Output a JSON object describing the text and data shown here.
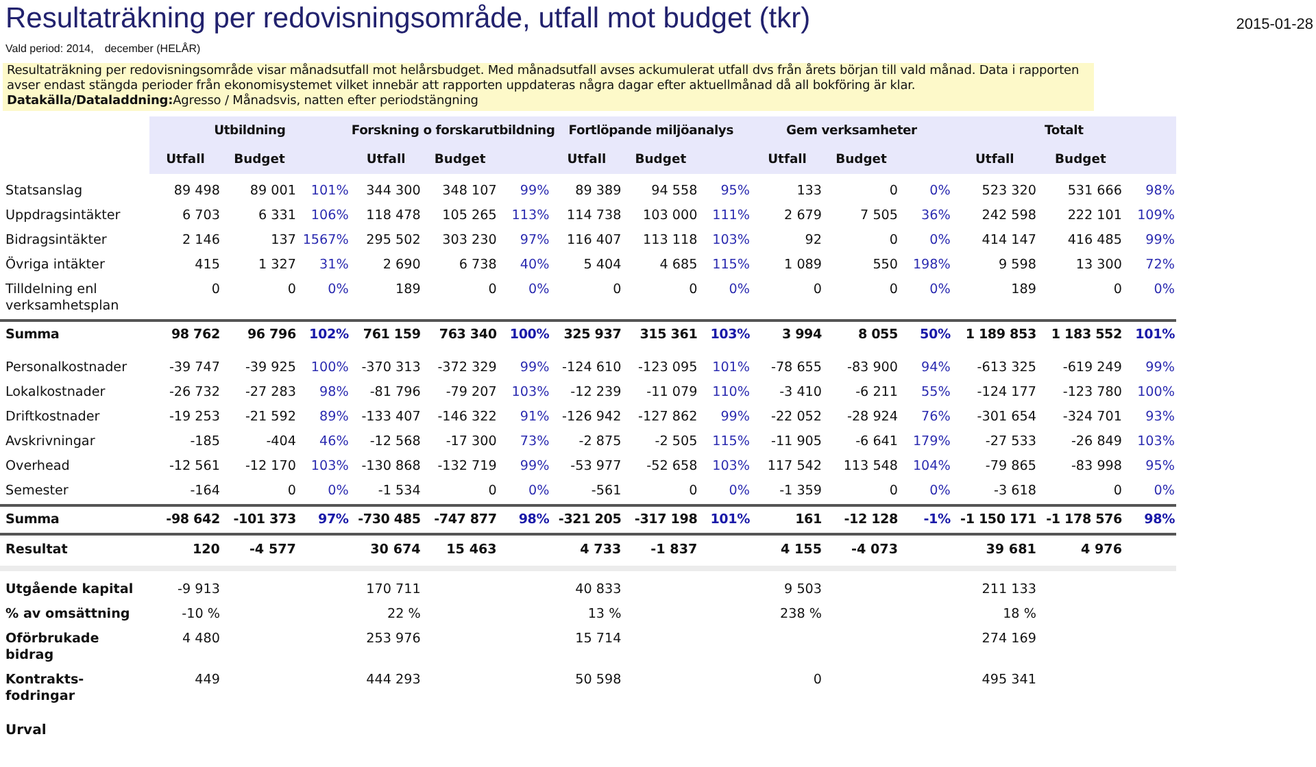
{
  "title": "Resultaträkning per redovisningsområde, utfall mot budget (tkr)",
  "date": "2015-01-28",
  "period": {
    "label": "Vald period: 2014,",
    "value": "december (HELÅR)"
  },
  "note": {
    "text": "Resultaträkning per redovisningsområde visar månadsutfall mot helårsbudget. Med månadsutfall avses ackumulerat utfall dvs från årets början till vald månad. Data i rapporten avser endast stängda perioder från ekonomisystemet vilket innebär att rapporten uppdateras några dagar efter aktuellmånad då all bokföring är klar.",
    "source_label": "Datakälla/Dataladdning:",
    "source_text": "Agresso / Månadsvis, natten efter periodstängning"
  },
  "table": {
    "areas": [
      {
        "name": "Utbildning",
        "columns": [
          "Utfall",
          "Budget"
        ]
      },
      {
        "name": "Forskning o forskarutbildning",
        "columns": [
          "Utfall",
          "Budget"
        ]
      },
      {
        "name": "Fortlöpande miljöanalys",
        "columns": [
          "Utfall",
          "Budget"
        ]
      },
      {
        "name": "Gem verksamheter",
        "columns": [
          "Utfall",
          "Budget"
        ]
      },
      {
        "name": "Totalt",
        "columns": [
          "Utfall",
          "Budget"
        ]
      }
    ],
    "rows": [
      {
        "kind": "line",
        "label": "Statsanslag",
        "cells": [
          "89 498",
          "89 001",
          "101%",
          "344 300",
          "348 107",
          "99%",
          "89 389",
          "94 558",
          "95%",
          "133",
          "0",
          "0%",
          "523 320",
          "531 666",
          "98%"
        ]
      },
      {
        "kind": "line",
        "label": "Uppdragsintäkter",
        "cells": [
          "6 703",
          "6 331",
          "106%",
          "118 478",
          "105 265",
          "113%",
          "114 738",
          "103 000",
          "111%",
          "2 679",
          "7 505",
          "36%",
          "242 598",
          "222 101",
          "109%"
        ]
      },
      {
        "kind": "line",
        "label": "Bidragsintäkter",
        "cells": [
          "2 146",
          "137",
          "1567%",
          "295 502",
          "303 230",
          "97%",
          "116 407",
          "113 118",
          "103%",
          "92",
          "0",
          "0%",
          "414 147",
          "416 485",
          "99%"
        ]
      },
      {
        "kind": "line",
        "label": "Övriga intäkter",
        "cells": [
          "415",
          "1 327",
          "31%",
          "2 690",
          "6 738",
          "40%",
          "5 404",
          "4 685",
          "115%",
          "1 089",
          "550",
          "198%",
          "9 598",
          "13 300",
          "72%"
        ]
      },
      {
        "kind": "line",
        "label": "Tilldelning enl verksamhetsplan",
        "cells": [
          "0",
          "0",
          "0%",
          "189",
          "0",
          "0%",
          "0",
          "0",
          "0%",
          "0",
          "0",
          "0%",
          "189",
          "0",
          "0%"
        ]
      },
      {
        "kind": "sum",
        "label": "Summa",
        "cells": [
          "98 762",
          "96 796",
          "102%",
          "761 159",
          "763 340",
          "100%",
          "325 937",
          "315 361",
          "103%",
          "3 994",
          "8 055",
          "50%",
          "1 189 853",
          "1 183 552",
          "101%"
        ]
      },
      {
        "kind": "line",
        "label": "Personalkostnader",
        "cells": [
          "-39 747",
          "-39 925",
          "100%",
          "-370 313",
          "-372 329",
          "99%",
          "-124 610",
          "-123 095",
          "101%",
          "-78 655",
          "-83 900",
          "94%",
          "-613 325",
          "-619 249",
          "99%"
        ]
      },
      {
        "kind": "line",
        "label": "Lokalkostnader",
        "cells": [
          "-26 732",
          "-27 283",
          "98%",
          "-81 796",
          "-79 207",
          "103%",
          "-12 239",
          "-11 079",
          "110%",
          "-3 410",
          "-6 211",
          "55%",
          "-124 177",
          "-123 780",
          "100%"
        ]
      },
      {
        "kind": "line",
        "label": "Driftkostnader",
        "cells": [
          "-19 253",
          "-21 592",
          "89%",
          "-133 407",
          "-146 322",
          "91%",
          "-126 942",
          "-127 862",
          "99%",
          "-22 052",
          "-28 924",
          "76%",
          "-301 654",
          "-324 701",
          "93%"
        ]
      },
      {
        "kind": "line",
        "label": "Avskrivningar",
        "cells": [
          "-185",
          "-404",
          "46%",
          "-12 568",
          "-17 300",
          "73%",
          "-2 875",
          "-2 505",
          "115%",
          "-11 905",
          "-6 641",
          "179%",
          "-27 533",
          "-26 849",
          "103%"
        ]
      },
      {
        "kind": "line",
        "label": "Overhead",
        "cells": [
          "-12 561",
          "-12 170",
          "103%",
          "-130 868",
          "-132 719",
          "99%",
          "-53 977",
          "-52 658",
          "103%",
          "117 542",
          "113 548",
          "104%",
          "-79 865",
          "-83 998",
          "95%"
        ]
      },
      {
        "kind": "line",
        "label": "Semester",
        "cells": [
          "-164",
          "0",
          "0%",
          "-1 534",
          "0",
          "0%",
          "-561",
          "0",
          "0%",
          "-1 359",
          "0",
          "0%",
          "-3 618",
          "0",
          "0%"
        ]
      },
      {
        "kind": "sum",
        "label": "Summa",
        "cells": [
          "-98 642",
          "-101 373",
          "97%",
          "-730 485",
          "-747 877",
          "98%",
          "-321 205",
          "-317 198",
          "101%",
          "161",
          "-12 128",
          "-1%",
          "-1 150 171",
          "-1 178 576",
          "98%"
        ]
      },
      {
        "kind": "result",
        "label": "Resultat",
        "cells": [
          "120",
          "-4 577",
          null,
          "30 674",
          "15 463",
          null,
          "4 733",
          "-1 837",
          null,
          "4 155",
          "-4 073",
          null,
          "39 681",
          "4 976",
          null
        ]
      },
      {
        "kind": "capital",
        "label": "Utgående kapital",
        "cells": [
          "-9 913",
          null,
          null,
          "170 711",
          null,
          null,
          "40 833",
          null,
          null,
          "9 503",
          null,
          null,
          "211 133",
          null,
          null
        ]
      },
      {
        "kind": "capital",
        "label": "% av omsättning",
        "cells": [
          "-10 %",
          null,
          null,
          "22 %",
          null,
          null,
          "13 %",
          null,
          null,
          "238 %",
          null,
          null,
          "18 %",
          null,
          null
        ]
      },
      {
        "kind": "capital",
        "label": "Oförbrukade bidrag",
        "cells": [
          "4 480",
          null,
          null,
          "253 976",
          null,
          null,
          "15 714",
          null,
          null,
          null,
          null,
          null,
          "274 169",
          null,
          null
        ]
      },
      {
        "kind": "capital",
        "label": "Kontrakts-fodringar",
        "cells": [
          "449",
          null,
          null,
          "444 293",
          null,
          null,
          "50 598",
          null,
          null,
          "0",
          null,
          null,
          "495 341",
          null,
          null
        ]
      }
    ]
  },
  "footer": {
    "heading": "Urval"
  }
}
